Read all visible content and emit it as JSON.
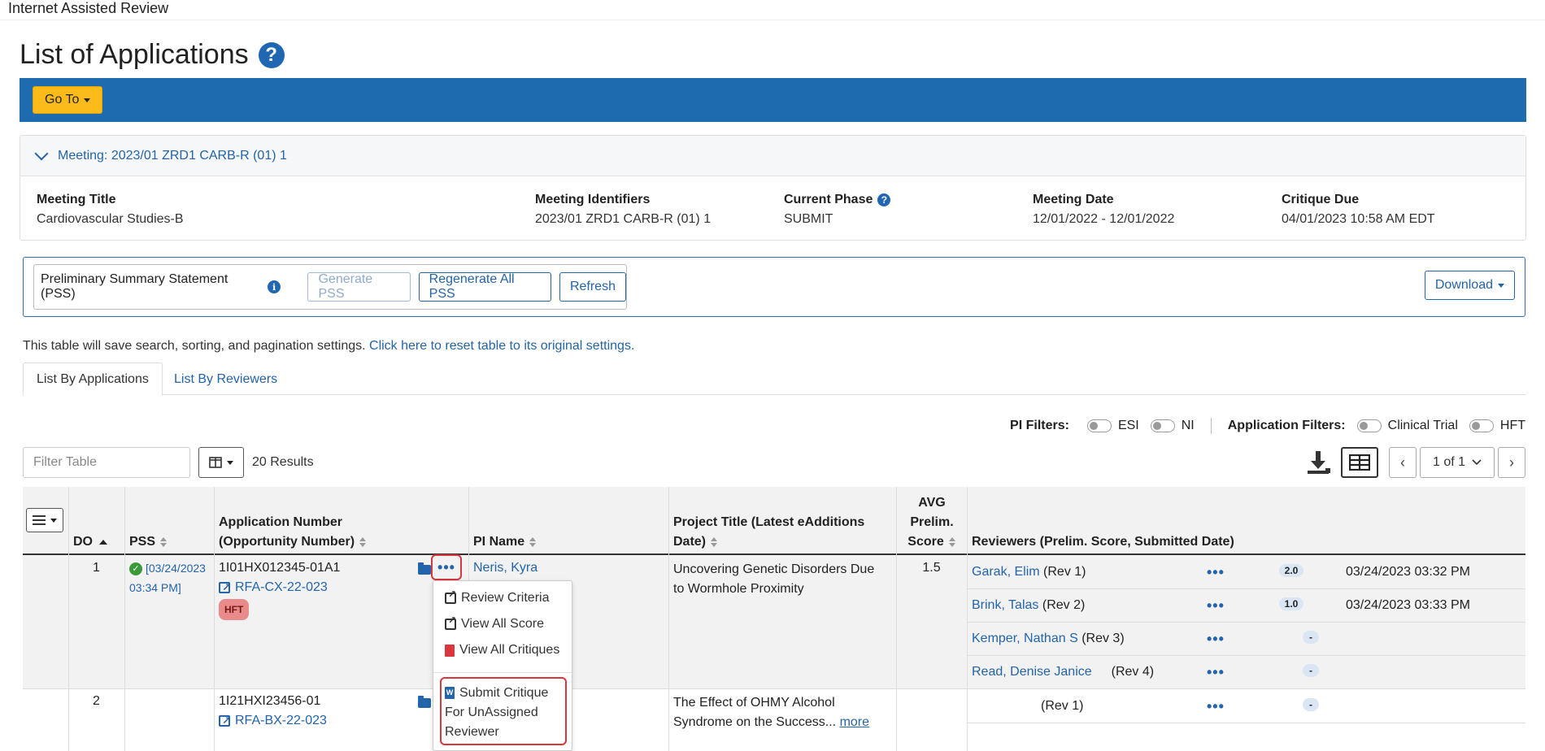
{
  "app": {
    "title": "Internet Assisted Review"
  },
  "page": {
    "title": "List of Applications"
  },
  "toolbar": {
    "goto_label": "Go To"
  },
  "meeting": {
    "header": "Meeting:  2023/01 ZRD1 CARB-R (01) 1",
    "fields": [
      {
        "label": "Meeting Title",
        "value": "Cardiovascular Studies-B"
      },
      {
        "label": "Meeting Identifiers",
        "value": "2023/01 ZRD1 CARB-R (01) 1"
      },
      {
        "label": "Current Phase",
        "value": "SUBMIT"
      },
      {
        "label": "Meeting Date",
        "value": "12/01/2022 - 12/01/2022"
      },
      {
        "label": "Critique Due",
        "value": "04/01/2023 10:58 AM EDT"
      }
    ]
  },
  "pss": {
    "label": "Preliminary Summary Statement (PSS)",
    "generate": "Generate PSS",
    "regenerate": "Regenerate All PSS",
    "refresh": "Refresh",
    "download": "Download"
  },
  "note": {
    "text": "This table will save search, sorting, and pagination settings.",
    "link": "Click here to reset table to its original settings."
  },
  "tabs": [
    {
      "label": "List By Applications",
      "active": true
    },
    {
      "label": "List By Reviewers",
      "active": false
    }
  ],
  "filters": {
    "pi_label": "PI Filters:",
    "esi": "ESI",
    "ni": "NI",
    "app_label": "Application Filters:",
    "clinical": "Clinical Trial",
    "hft": "HFT"
  },
  "table_controls": {
    "filter_placeholder": "Filter Table",
    "results": "20 Results",
    "page": "1 of 1"
  },
  "columns": {
    "do": "DO",
    "pss": "PSS",
    "app_num_1": "Application Number",
    "app_num_2": "(Opportunity Number)",
    "pi": "PI Name",
    "title_1": "Project Title (Latest eAdditions",
    "title_2": "Date)",
    "avg_1": "AVG",
    "avg_2": "Prelim.",
    "avg_3": "Score",
    "reviewers": "Reviewers (Prelim. Score, Submitted Date)"
  },
  "rows": [
    {
      "do": "1",
      "pss_date_1": "[03/24/2023",
      "pss_date_2": "03:34 PM]",
      "app_number": "1I01HX012345-01A1",
      "opportunity": "RFA-CX-22-023",
      "badge": "HFT",
      "pi": "Neris, Kyra",
      "title_1": "Uncovering Genetic  Disorders Due",
      "title_2": "to Wormhole Proximity",
      "avg": "1.5",
      "reviewers": [
        {
          "name": "Garak, Elim",
          "role": "(Rev 1)",
          "score": "2.0",
          "date": "03/24/2023 03:32 PM"
        },
        {
          "name": "Brink, Talas",
          "role": "(Rev 2)",
          "score": "1.0",
          "date": "03/24/2023 03:33 PM"
        },
        {
          "name": "Kemper, Nathan S",
          "role": "(Rev 3)",
          "score": "-",
          "date": ""
        },
        {
          "name": "Read, Denise Janice",
          "role": "(Rev 4)",
          "score": "-",
          "date": ""
        }
      ]
    },
    {
      "do": "2",
      "app_number": "1I21HXI23456-01",
      "opportunity": "RFA-BX-22-023",
      "title_1": "The Effect of OHMY Alcohol",
      "title_2": "Syndrome on the Success...",
      "more": "more",
      "reviewers": [
        {
          "name": "",
          "role": "(Rev 1)",
          "score": "-",
          "date": ""
        }
      ]
    }
  ],
  "action_menu": {
    "review_criteria": "Review Criteria",
    "view_all_score": "View All Score",
    "view_all_critiques": "View All Critiques",
    "submit_1": "Submit Critique",
    "submit_2": "For UnAssigned",
    "submit_3": "Reviewer"
  },
  "colors": {
    "primary": "#1f6bb0",
    "accent": "#fbbb1a",
    "link": "#2364aa",
    "highlight": "#d9363e"
  }
}
